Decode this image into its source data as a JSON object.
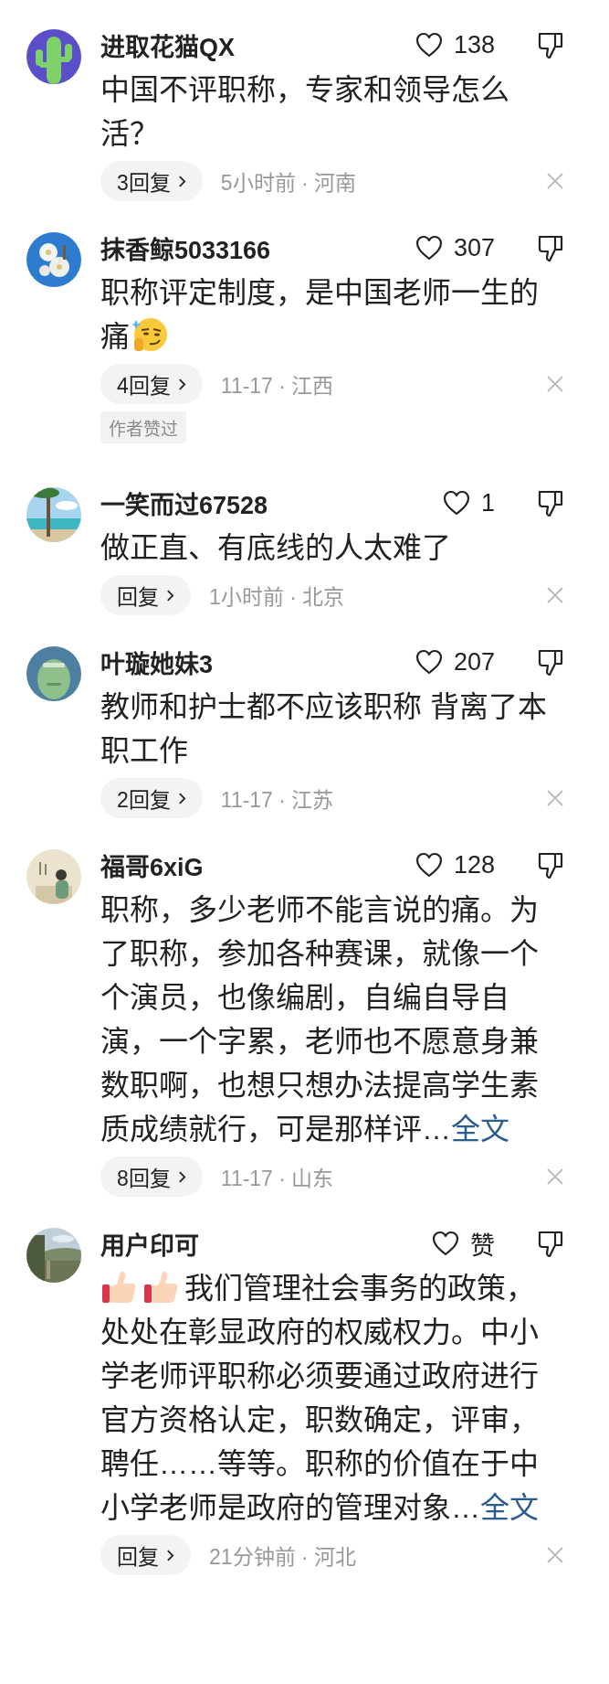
{
  "comments": [
    {
      "avatar": {
        "kind": "cactus"
      },
      "username": "进取花猫QX",
      "likes": "138",
      "text": "中国不评职称，专家和领导怎么活？",
      "replies": "3回复",
      "meta": "5小时前 · 河南"
    },
    {
      "avatar": {
        "kind": "flower"
      },
      "username": "抹香鲸5033166",
      "likes": "307",
      "text": "职称评定制度，是中国老师一生的痛",
      "trail_icons": [
        {
          "kind": "smirk"
        }
      ],
      "replies": "4回复",
      "meta": "11-17 · 江西",
      "badge": "作者赞过"
    },
    {
      "avatar": {
        "kind": "beach"
      },
      "username": "一笑而过67528",
      "likes": "1",
      "text": "做正直、有底线的人太难了",
      "replies": "回复",
      "meta": "1小时前 · 北京"
    },
    {
      "avatar": {
        "kind": "blob"
      },
      "username": "叶璇她妹3",
      "likes": "207",
      "text": "教师和护士都不应该职称 背离了本职工作",
      "replies": "2回复",
      "meta": "11-17 · 江苏"
    },
    {
      "avatar": {
        "kind": "painting"
      },
      "username": "福哥6xiG",
      "likes": "128",
      "text": "职称，多少老师不能言说的痛。为了职称，参加各种赛课，就像一个个演员，也像编剧，自编自导自演，一个字累，老师也不愿意身兼数职啊，也想只想办法提高学生素质成绩就行，可是那样评…",
      "more_link": "全文",
      "replies": "8回复",
      "meta": "11-17 · 山东"
    },
    {
      "avatar": {
        "kind": "landscape"
      },
      "username": "用户印可",
      "likes": "赞",
      "lead_icons": [
        {
          "kind": "thumbs-up"
        },
        {
          "kind": "thumbs-up"
        }
      ],
      "text": "我们管理社会事务的政策，处处在彰显政府的权威权力。中小学老师评职称必须要通过政府进行官方资格认定，职数确定，评审，聘任……等等。职称的价值在于中小学老师是政府的管理对象…",
      "more_link": "全文",
      "replies": "回复",
      "meta": "21分钟前 · 河北"
    }
  ]
}
